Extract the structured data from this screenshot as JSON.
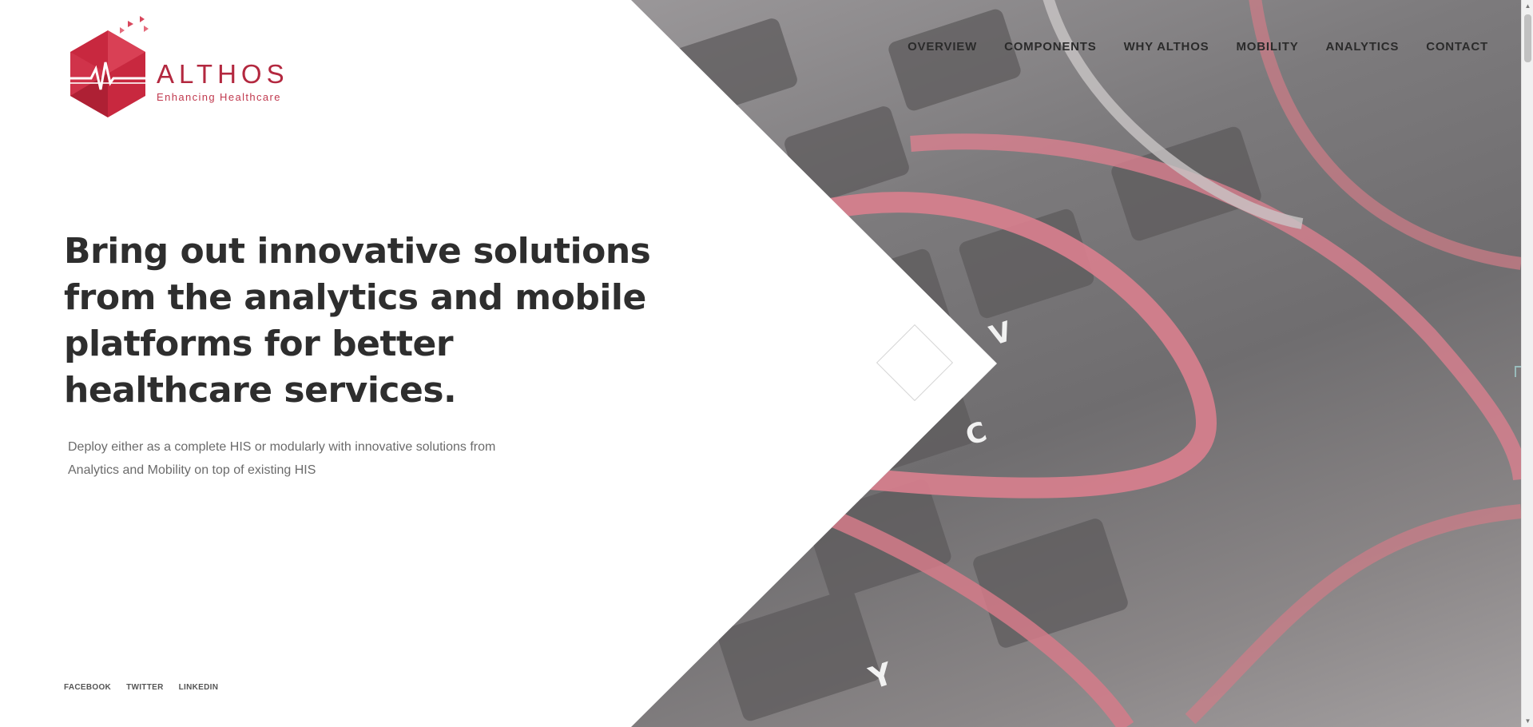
{
  "brand": {
    "name": "ALTHOS",
    "tagline": "Enhancing Healthcare",
    "logo_icon": "heartbeat-hexagon-icon",
    "accent_color": "#b3283f"
  },
  "nav": {
    "items": [
      {
        "label": "OVERVIEW"
      },
      {
        "label": "COMPONENTS"
      },
      {
        "label": "WHY ALTHOS"
      },
      {
        "label": "MOBILITY"
      },
      {
        "label": "ANALYTICS"
      },
      {
        "label": "CONTACT"
      }
    ]
  },
  "hero": {
    "title": "Bring out innovative solutions from the analytics and mobile platforms for better healthcare services.",
    "subtitle_line1": "Deploy either as a complete HIS or modularly with innovative solutions from",
    "subtitle_line2": "Analytics and Mobility on top of existing HIS",
    "image_subject": "stethoscope on keyboard"
  },
  "social": {
    "items": [
      {
        "label": "FACEBOOK"
      },
      {
        "label": "TWITTER"
      },
      {
        "label": "LINKEDIN"
      }
    ]
  }
}
